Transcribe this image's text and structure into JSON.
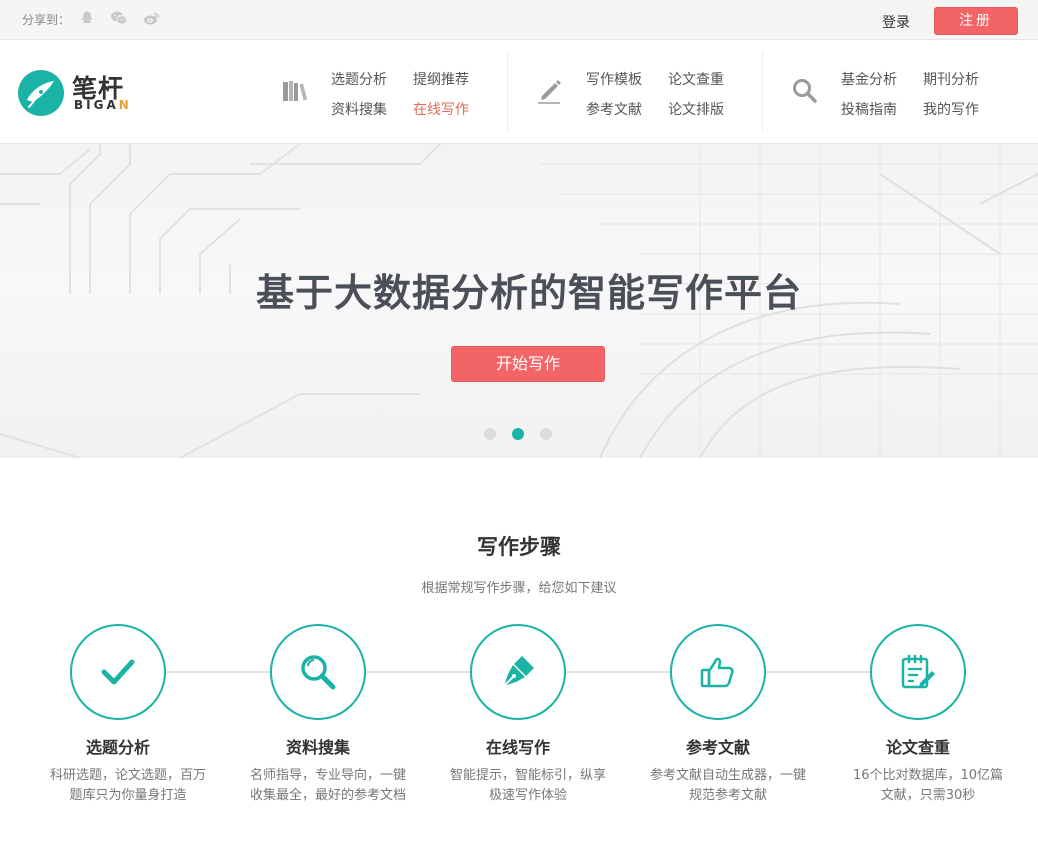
{
  "topbar": {
    "share_label": "分享到：",
    "share_icons": [
      "qq-icon",
      "wechat-icon",
      "weibo-icon"
    ],
    "login_label": "登录",
    "register_label": "注册"
  },
  "logo": {
    "cn": "笔杆",
    "en_main": "BIGA",
    "en_accent": "N"
  },
  "nav": {
    "groups": [
      {
        "icon": "books-icon",
        "links": [
          "选题分析",
          "提纲推荐",
          "资料搜集",
          "在线写作"
        ],
        "active_index": 3
      },
      {
        "icon": "pen-icon",
        "links": [
          "写作模板",
          "论文查重",
          "参考文献",
          "论文排版"
        ]
      },
      {
        "icon": "search-icon",
        "links": [
          "基金分析",
          "期刊分析",
          "投稿指南",
          "我的写作"
        ]
      }
    ]
  },
  "hero": {
    "title": "基于大数据分析的智能写作平台",
    "button_label": "开始写作",
    "slide_count": 3,
    "active_slide": 2
  },
  "steps_section": {
    "title": "写作步骤",
    "subtitle": "根据常规写作步骤，给您如下建议",
    "steps": [
      {
        "icon": "checkmark-icon",
        "title": "选题分析",
        "desc": "科研选题，论文选题，百万题库只为你量身打造"
      },
      {
        "icon": "magnifier-icon",
        "title": "资料搜集",
        "desc": "名师指导，专业导向，一键收集最全，最好的参考文档"
      },
      {
        "icon": "fountain-pen-icon",
        "title": "在线写作",
        "desc": "智能提示，智能标引，纵享极速写作体验"
      },
      {
        "icon": "thumbs-up-icon",
        "title": "参考文献",
        "desc": "参考文献自动生成器，一键规范参考文献"
      },
      {
        "icon": "document-edit-icon",
        "title": "论文查重",
        "desc": "16个比对数据库，10亿篇文献，只需30秒"
      }
    ]
  },
  "colors": {
    "accent": "#1ab3a6",
    "brand_red": "#f26466",
    "active_nav": "#e26b5a"
  }
}
